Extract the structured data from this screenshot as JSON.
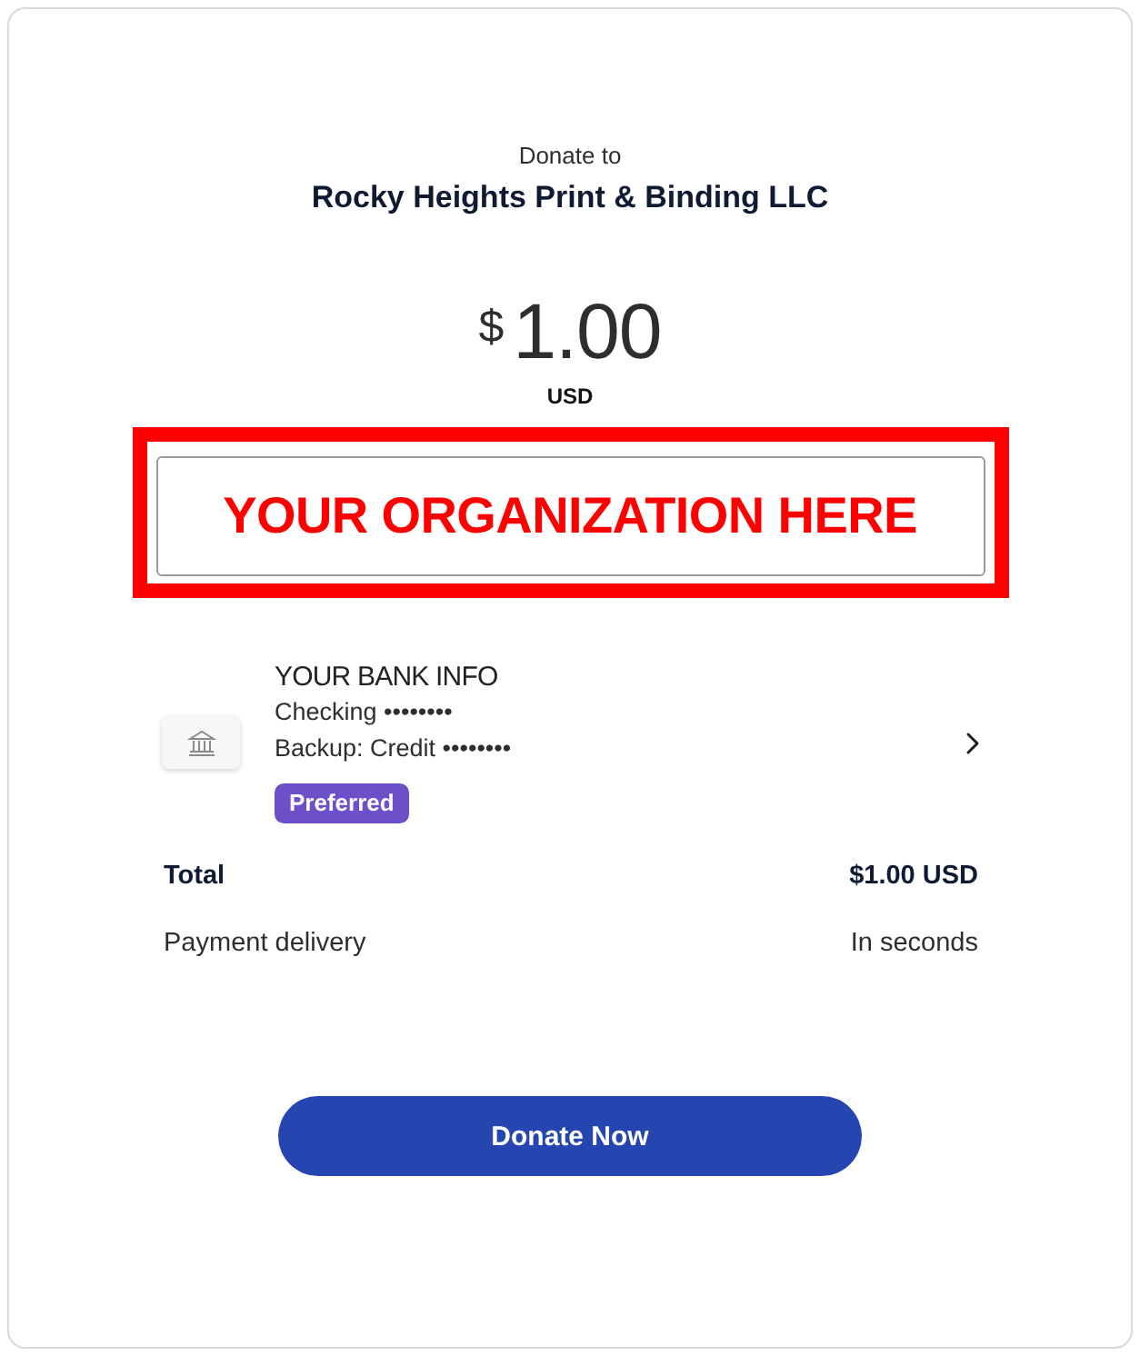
{
  "header": {
    "label": "Donate to",
    "recipient": "Rocky Heights Print & Binding LLC"
  },
  "amount": {
    "currency_symbol": "$",
    "value": "1.00",
    "currency": "USD"
  },
  "organization_field": {
    "value": "YOUR ORGANIZATION HERE"
  },
  "payment_method": {
    "name": "YOUR BANK INFO",
    "lines": [
      "Checking ••••••••",
      "Backup: Credit ••••••••"
    ],
    "badge": "Preferred"
  },
  "summary": [
    {
      "kind": "total",
      "label": "Total",
      "value": "$1.00 USD"
    },
    {
      "kind": "detail",
      "label": "Payment delivery",
      "value": "In seconds"
    }
  ],
  "primary_button": {
    "label": "Donate Now"
  }
}
